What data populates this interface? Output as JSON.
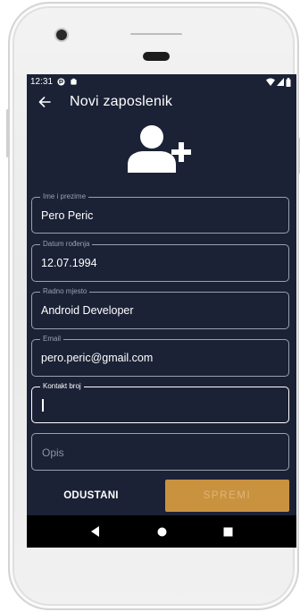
{
  "status_bar": {
    "time": "12:31",
    "left_icons": [
      "pocket-casts-icon",
      "notification-icon"
    ],
    "right_icons": [
      "wifi-icon",
      "signal-icon",
      "battery-icon"
    ]
  },
  "app_bar": {
    "back_icon": "back-arrow-icon",
    "title": "Novi zaposlenik"
  },
  "header_icon": "add-user-icon",
  "form": {
    "fields": [
      {
        "label": "Ime i prezime",
        "value": "Pero Peric"
      },
      {
        "label": "Datum rođenja",
        "value": "12.07.1994"
      },
      {
        "label": "Radno mjesto",
        "value": "Android Developer"
      },
      {
        "label": "Email",
        "value": "pero.peric@gmail.com"
      },
      {
        "label": "Kontakt broj",
        "value": "",
        "focused": true
      },
      {
        "label": "",
        "placeholder": "Opis",
        "value": ""
      }
    ]
  },
  "actions": {
    "cancel_label": "ODUSTANI",
    "save_label": "SPREMI"
  },
  "nav_bar": {
    "icons": [
      "nav-back-icon",
      "nav-home-icon",
      "nav-recents-icon"
    ]
  },
  "colors": {
    "screen_background": "#1b2236",
    "accent": "#c9923f",
    "field_border": "#9aa0ad",
    "text": "#ffffff"
  }
}
